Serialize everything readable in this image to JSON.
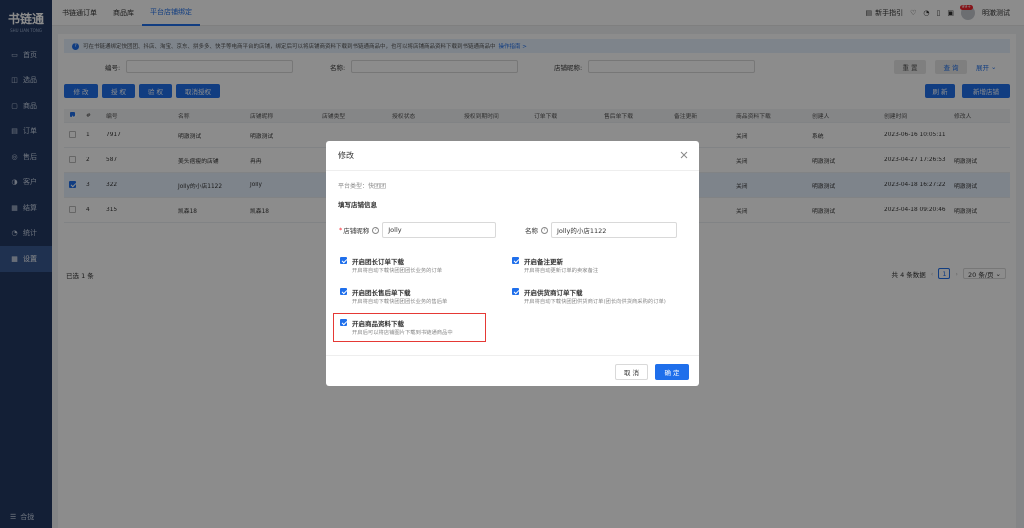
{
  "app": {
    "logo_text": "书链通",
    "logo_sub": "SHU LIAN TONG"
  },
  "sidebar": {
    "items": [
      {
        "label": "首页",
        "icon": "monitor-icon"
      },
      {
        "label": "选品",
        "icon": "bag-icon"
      },
      {
        "label": "商品",
        "icon": "box-icon"
      },
      {
        "label": "订单",
        "icon": "order-icon"
      },
      {
        "label": "售后",
        "icon": "service-icon"
      },
      {
        "label": "客户",
        "icon": "users-icon"
      },
      {
        "label": "结算",
        "icon": "settle-icon"
      },
      {
        "label": "统计",
        "icon": "chart-icon"
      },
      {
        "label": "设置",
        "icon": "grid-icon"
      }
    ],
    "collapse_label": "合拢"
  },
  "topbar": {
    "tabs": [
      "书链通订单",
      "商品库",
      "平台店铺绑定"
    ],
    "guide": "新手指引",
    "badge": "99+",
    "user": "明澈测试"
  },
  "notice": {
    "text": "可在书链通绑定快团团、抖店、淘宝、京东、拼多多、快手等电商平台的店铺，绑定后可以将店铺商资料下载到书链通商品中，也可以将店铺商品资料下载到书链通商品中",
    "link": "操作指南 >"
  },
  "filters": {
    "code_label": "编号:",
    "name_label": "名称:",
    "nick_label": "店铺昵称:",
    "reset": "重 置",
    "query": "查 询",
    "expand": "展开"
  },
  "actions": {
    "edit": "修 改",
    "auth": "授 权",
    "check": "验 权",
    "cancel_auth": "取消授权",
    "refresh": "刷 新",
    "new_store": "新增店铺"
  },
  "table": {
    "headers": [
      "#",
      "编号",
      "名称",
      "店铺昵称",
      "店铺类型",
      "授权状态",
      "授权到期时间",
      "订单下载",
      "售后单下载",
      "备注更新",
      "商品资料下载",
      "创建人",
      "创建时间",
      "修改人"
    ],
    "rows": [
      {
        "idx": "1",
        "code": "7917",
        "name": "明澈测试",
        "nick": "明澈测试",
        "product": "关闭",
        "creator": "系统",
        "created": "2023-06-16 10:05:11",
        "modifier": ""
      },
      {
        "idx": "2",
        "code": "587",
        "name": "美头痞瘦的店铺",
        "nick": "冉冉",
        "product": "关闭",
        "creator": "明澈测试",
        "created": "2023-04-27 17:26:53",
        "modifier": "明澈测试"
      },
      {
        "idx": "3",
        "code": "322",
        "name": "Jolly的小店1122",
        "nick": "Jolly",
        "product": "关闭",
        "creator": "明澈测试",
        "created": "2023-04-18 16:27:22",
        "modifier": "明澈测试"
      },
      {
        "idx": "4",
        "code": "315",
        "name": "凯森18",
        "nick": "凯森18",
        "product": "关闭",
        "creator": "明澈测试",
        "created": "2023-04-18 09:20:46",
        "modifier": "明澈测试"
      }
    ]
  },
  "footer": {
    "selected": "已选 1 条",
    "total": "共 4 条数据",
    "page": "1",
    "page_size": "20 条/页"
  },
  "modal": {
    "title": "修改",
    "platform_type": "平台类型：快团团",
    "section": "填写店铺信息",
    "nick_label": "店铺昵称",
    "nick_value": "Jolly",
    "name_label": "名称",
    "name_value": "Jolly的小店1122",
    "options": [
      {
        "title": "开启团长订单下载",
        "desc": "开启将自动下载快团团团长业务的订单"
      },
      {
        "title": "开启备注更新",
        "desc": "开启将自动更新订单的卖家备注"
      },
      {
        "title": "开启团长售后单下载",
        "desc": "开启将自动下载快团团团长业务的售后单"
      },
      {
        "title": "开启供货商订单下载",
        "desc": "开启将自动下载快团团供货商订单(团长向供货商采购的订单)"
      },
      {
        "title": "开启商品资料下载",
        "desc": "开启后可以将店铺图片下载到书链通商品中"
      }
    ],
    "cancel": "取 消",
    "ok": "确 定"
  }
}
